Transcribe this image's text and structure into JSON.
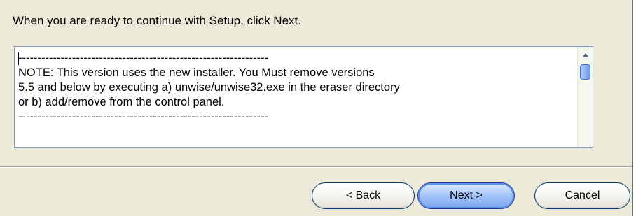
{
  "instruction": "When you are ready to continue with Setup, click Next.",
  "memo": {
    "lines": [
      "-----------------------------------------------------------------",
      "NOTE: This version uses the new installer. You Must remove versions",
      "5.5 and below by executing a) unwise/unwise32.exe in the eraser directory",
      "or b) add/remove from the control panel.",
      "-----------------------------------------------------------------"
    ]
  },
  "scrollbar": {
    "up_icon": "scroll-up-arrow",
    "position": 0.0
  },
  "buttons": {
    "back": "< Back",
    "next": "Next >",
    "cancel": "Cancel"
  },
  "colors": {
    "dialog_bg": "#ece9d8",
    "memo_border": "#7f9db9",
    "default_button": "#7aa4f0"
  }
}
